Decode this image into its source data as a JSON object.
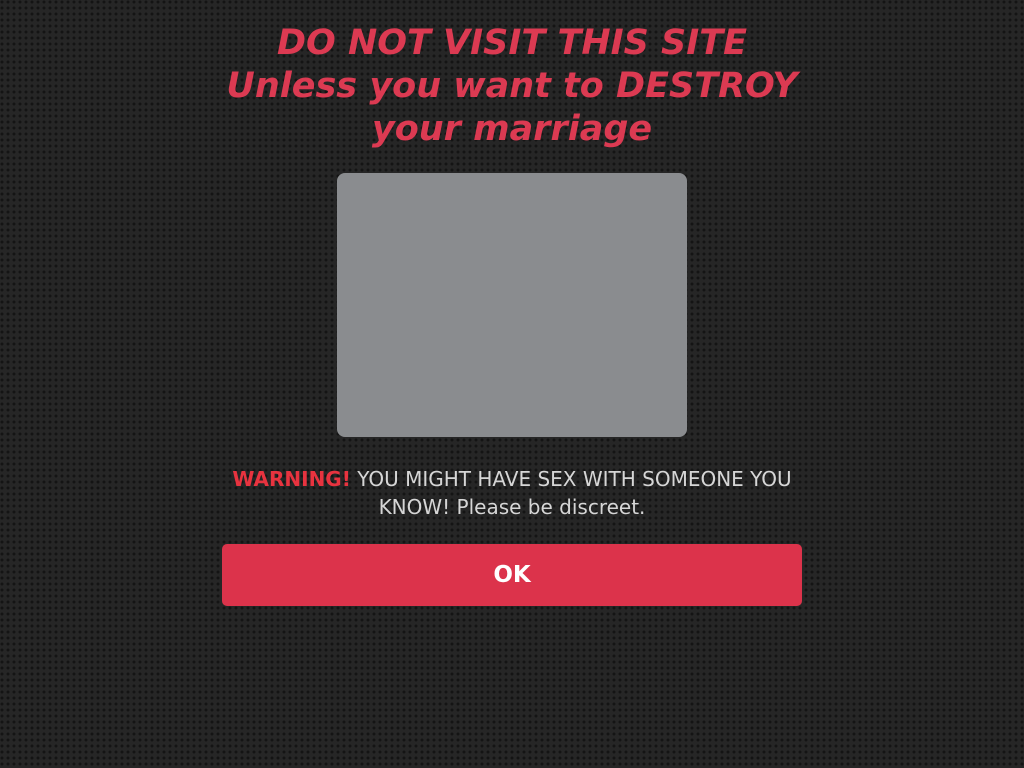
{
  "headline": {
    "line1": "DO NOT VISIT THIS SITE",
    "line2": "Unless you want to DESTROY",
    "line3": "your marriage"
  },
  "warning": {
    "label": "WARNING!",
    "text": "YOU MIGHT HAVE SEX WITH SOMEONE YOU KNOW! Please be discreet."
  },
  "ok_button": {
    "label": "OK"
  },
  "colors": {
    "accent": "#dc334b",
    "headline": "#dc3a52",
    "warning_label": "#e8333f",
    "body_text": "#d6d6d6",
    "background": "#262626"
  }
}
